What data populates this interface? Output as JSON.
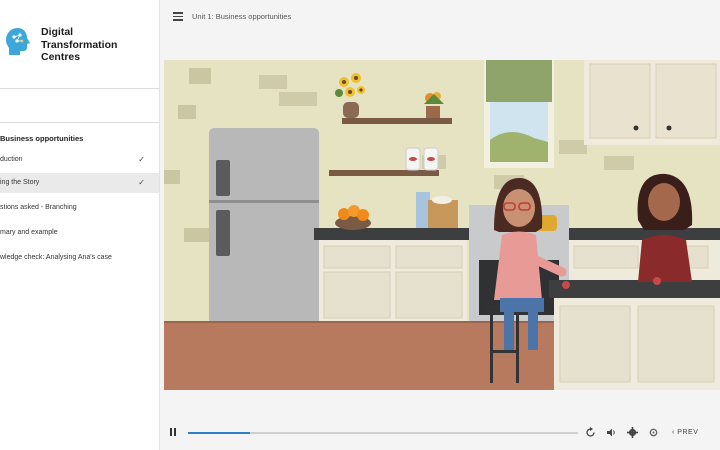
{
  "brand": {
    "name": "Digital Transformation Centres",
    "line1": "Digital",
    "line2": "Transformation",
    "line3": "Centres"
  },
  "header": {
    "title": "Unit 1: Business opportunities"
  },
  "sidebar": {
    "section_title": "Business opportunities",
    "lessons": [
      {
        "label": "duction",
        "completed": true,
        "active": false
      },
      {
        "label": "ing the Story",
        "completed": true,
        "active": true
      },
      {
        "label": "stions asked - Branching",
        "completed": false,
        "active": false
      },
      {
        "label": "mary and example",
        "completed": false,
        "active": false
      },
      {
        "label": "wledge check: Analysing Ana's case",
        "completed": false,
        "active": false
      }
    ],
    "check_glyph": "✓"
  },
  "player": {
    "progress": 0.16,
    "prev_label": "PREV",
    "accent": "#2f80c8"
  },
  "icons": [
    "menu-icon",
    "pause-icon",
    "replay-icon",
    "volume-icon",
    "settings-icon",
    "gear-icon",
    "chevron-left-icon"
  ]
}
